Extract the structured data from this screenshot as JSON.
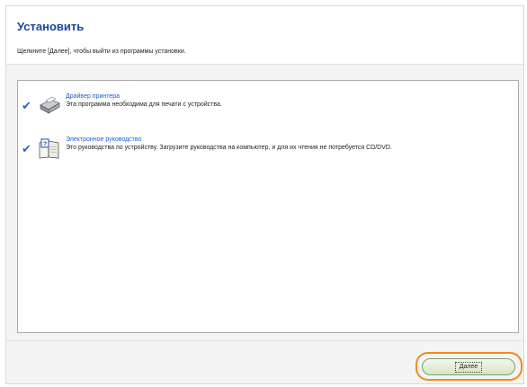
{
  "header": {
    "title": "Установить",
    "subtitle": "Щелкните [Далее], чтобы выйти из программы установки."
  },
  "items": [
    {
      "title": "Драйвер принтера",
      "description": "Эта программа необходима для печати с устройства.",
      "checked": true,
      "icon": "printer-icon"
    },
    {
      "title": "Электронное руководство",
      "description": "Это руководства по устройству. Загрузите руководства на компьютер, и для их чтения не потребуется CD/DVD.",
      "checked": true,
      "icon": "manual-book-icon"
    }
  ],
  "footer": {
    "next_label": "Далее"
  },
  "colors": {
    "title": "#1c45a6",
    "link": "#1d5fcc",
    "check": "#2a64c6",
    "highlight": "#f08a1c"
  }
}
